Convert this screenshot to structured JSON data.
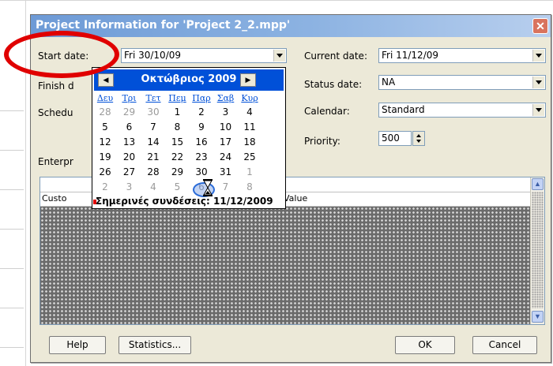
{
  "dialog": {
    "title": "Project Information for 'Project 2_2.mpp'",
    "close_glyph": "✕"
  },
  "fields": {
    "start_date_label": "Start date:",
    "start_date_value": "Fri 30/10/09",
    "finish_date_label": "Finish d",
    "schedule_label": "Schedu",
    "current_date_label": "Current date:",
    "current_date_value": "Fri 11/12/09",
    "status_date_label": "Status date:",
    "status_date_value": "NA",
    "calendar_label": "Calendar:",
    "calendar_value": "Standard",
    "priority_label": "Priority:",
    "priority_value": "500",
    "enterprise_label": "Enterpr"
  },
  "grid": {
    "custom_col": "Custo",
    "value_col": "Value"
  },
  "calendar": {
    "month_title": "Οκτώβριος 2009",
    "prev": "◀",
    "next": "▶",
    "weekdays": [
      "Δευ",
      "Τρι",
      "Τετ",
      "Πεμ",
      "Παρ",
      "Σαβ",
      "Κυρ"
    ],
    "weeks": [
      [
        "28",
        "29",
        "30",
        "1",
        "2",
        "3",
        "4"
      ],
      [
        "5",
        "6",
        "7",
        "8",
        "9",
        "10",
        "11"
      ],
      [
        "12",
        "13",
        "14",
        "15",
        "16",
        "17",
        "18"
      ],
      [
        "19",
        "20",
        "21",
        "22",
        "23",
        "24",
        "25"
      ],
      [
        "26",
        "27",
        "28",
        "29",
        "30",
        "31",
        "1"
      ],
      [
        "2",
        "3",
        "4",
        "5",
        "6",
        "7",
        "8"
      ]
    ],
    "today_text": "Σημερινές συνδέσεις: 11/12/2009"
  },
  "buttons": {
    "help": "Help",
    "statistics": "Statistics...",
    "ok": "OK",
    "cancel": "Cancel"
  },
  "colors": {
    "title_bar": "#6d9ad6",
    "calendar_header": "#0050d8",
    "annotation_red": "#e00000"
  },
  "icons": {
    "close": "close-icon",
    "dropdown": "chevron-down-icon",
    "spinner": "spinner-icon",
    "hourglass": "hourglass-icon"
  }
}
